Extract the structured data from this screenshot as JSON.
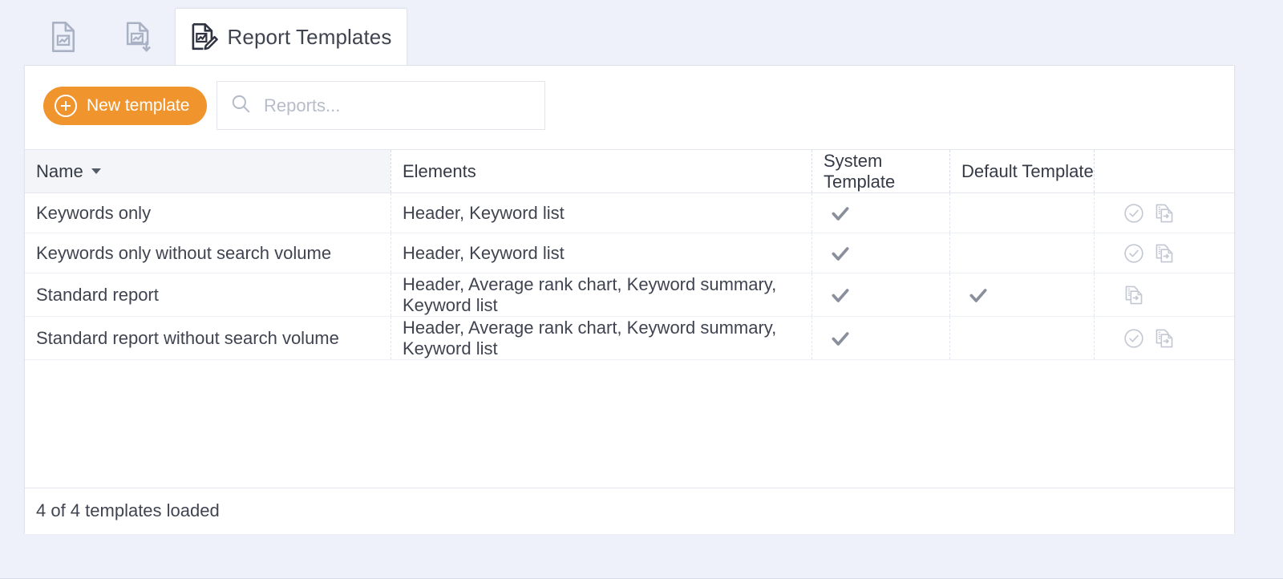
{
  "app": {
    "background_color": "#eef1f9",
    "accent_color": "#f0942e"
  },
  "tabs": [
    {
      "icon": "report-document-icon",
      "label": "",
      "active": false
    },
    {
      "icon": "report-document-download-icon",
      "label": "",
      "active": false
    },
    {
      "icon": "report-template-edit-icon",
      "label": "Report Templates",
      "active": true
    }
  ],
  "toolbar": {
    "new_template_label": "New template",
    "plus_icon": "plus-circle-icon",
    "search": {
      "icon": "search-icon",
      "value": "",
      "placeholder": "Reports..."
    }
  },
  "table": {
    "columns": [
      {
        "key": "name",
        "label": "Name",
        "sorted": true,
        "sort_icon": "caret-down-icon"
      },
      {
        "key": "elements",
        "label": "Elements"
      },
      {
        "key": "system",
        "label": "System Template"
      },
      {
        "key": "default",
        "label": "Default Template"
      },
      {
        "key": "actions",
        "label": ""
      }
    ],
    "rows": [
      {
        "name": "Keywords only",
        "elements": "Header, Keyword list",
        "system_template": true,
        "default_template": false,
        "actions": [
          "set-default-icon",
          "duplicate-icon"
        ]
      },
      {
        "name": "Keywords only without search volume",
        "elements": "Header, Keyword list",
        "system_template": true,
        "default_template": false,
        "actions": [
          "set-default-icon",
          "duplicate-icon"
        ]
      },
      {
        "name": "Standard report",
        "elements": "Header, Average rank chart, Keyword summary, Keyword list",
        "system_template": true,
        "default_template": true,
        "actions": [
          "duplicate-icon"
        ]
      },
      {
        "name": "Standard report without search volume",
        "elements": "Header, Average rank chart, Keyword summary, Keyword list",
        "system_template": true,
        "default_template": false,
        "actions": [
          "set-default-icon",
          "duplicate-icon"
        ]
      }
    ]
  },
  "footer": {
    "status": "4 of 4 templates loaded"
  }
}
